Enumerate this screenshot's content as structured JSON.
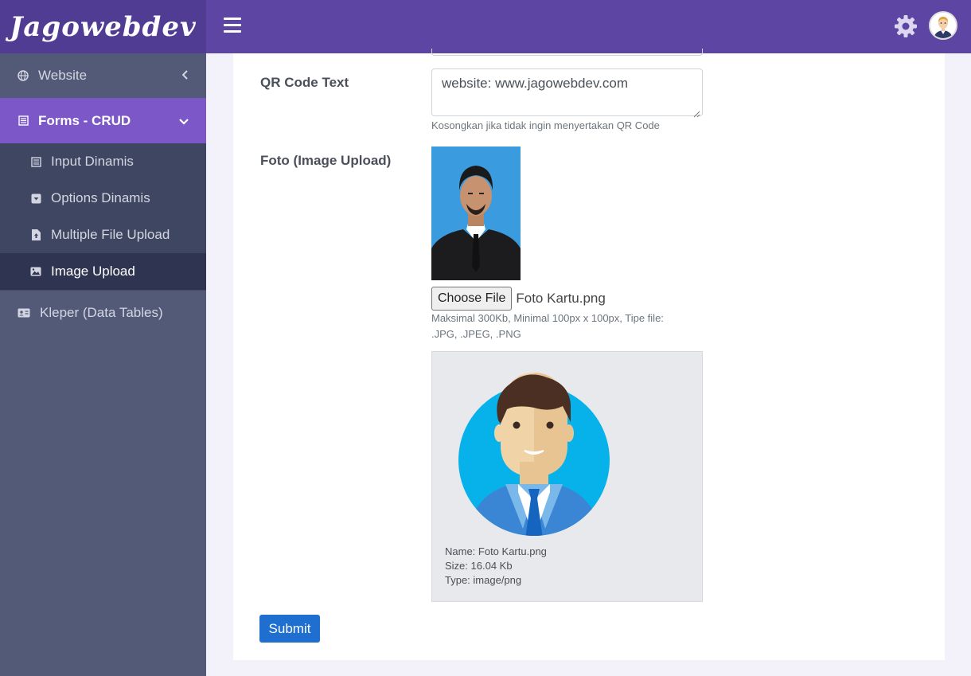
{
  "brand": {
    "name": "Jagowebdev"
  },
  "sidebar": {
    "website": {
      "label": "Website",
      "icon": "globe-icon"
    },
    "forms": {
      "label": "Forms - CRUD",
      "icon": "form-icon"
    },
    "sub_items": [
      {
        "label": "Input Dinamis",
        "icon": "form-icon"
      },
      {
        "label": "Options Dinamis",
        "icon": "dropdown-icon"
      },
      {
        "label": "Multiple File Upload",
        "icon": "file-upload-icon"
      },
      {
        "label": "Image Upload",
        "icon": "image-icon"
      }
    ],
    "kleper": {
      "label": "Kleper (Data Tables)",
      "icon": "id-card-icon"
    }
  },
  "header": {
    "menu_icon": "hamburger-icon",
    "settings_icon": "gear-icon"
  },
  "form": {
    "qr_label": "QR Code Text",
    "qr_value": "website: www.jagowebdev.com",
    "qr_help": "Kosongkan jika tidak ingin menyertakan QR Code",
    "foto_label": "Foto (Image Upload)",
    "choose_file": "Choose File",
    "file_name": "Foto Kartu.png",
    "file_help_line1": "Maksimal 300Kb, Minimal 100px x 100px, Tipe file:",
    "file_help_line2": ".JPG, .JPEG, .PNG",
    "preview": {
      "name": "Name: Foto Kartu.png",
      "size": "Size: 16.04 Kb",
      "type": "Type: image/png"
    },
    "submit": "Submit"
  },
  "colors": {
    "brand_bg": "#513c94",
    "topbar_bg": "#5c45a3",
    "sidebar_bg": "#535a78",
    "active_menu": "#7b57c7",
    "submit_btn": "#1f6fd0"
  }
}
